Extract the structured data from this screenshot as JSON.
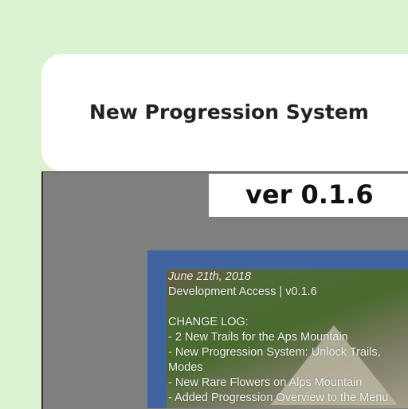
{
  "header": {
    "title": "New Progression System"
  },
  "version_label": "ver 0.1.6",
  "changelog": {
    "date": "June 21th, 2018",
    "build": "Development Access | v0.1.6",
    "heading": "CHANGE LOG:",
    "lines": [
      "- 2 New Trails for the Aps Mountain",
      "- New Progression System: Unlock Trails,",
      "Modes",
      "- New Rare Flowers on Alps Mountain",
      "- Added Progression Overview to the Menu"
    ]
  },
  "colors": {
    "background": "#dcf3d2",
    "frame": "#4064a0",
    "panel": "#7f7f7f"
  }
}
